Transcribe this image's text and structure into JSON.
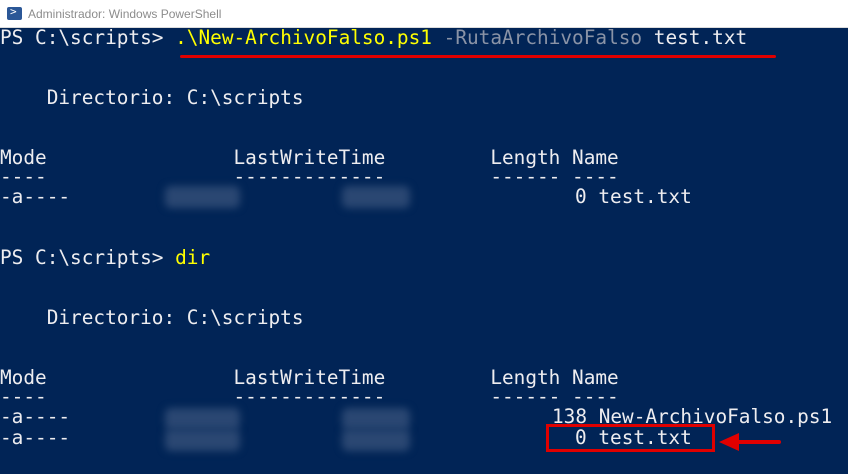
{
  "window": {
    "title": "Administrador: Windows PowerShell"
  },
  "console": {
    "prompt1": "PS C:\\scripts> ",
    "cmd1_script": ".\\New-ArchivoFalso.ps1",
    "cmd1_param": " -RutaArchivoFalso",
    "cmd1_value": " test.txt",
    "dir1": "    Directorio: C:\\scripts",
    "header": "Mode                LastWriteTime         Length Name",
    "separator": "----                -------------         ------ ----",
    "row1_mode": "-a----",
    "row1_tail": "0 test.txt",
    "prompt2": "PS C:\\scripts> ",
    "cmd2": "dir",
    "dir2": "    Directorio: C:\\scripts",
    "header2": "Mode                LastWriteTime         Length Name",
    "separator2": "----                -------------         ------ ----",
    "row2_mode": "-a----",
    "row2_tail": "138 New-ArchivoFalso.ps1",
    "row3_mode": "-a----",
    "row3_tail": "0 test.txt"
  },
  "colors": {
    "background": "#012456",
    "text": "#eeedf0",
    "command": "#ffff00",
    "parameter": "#8a93a6",
    "annotation": "#e00000"
  },
  "icons": [
    "powershell-icon"
  ]
}
